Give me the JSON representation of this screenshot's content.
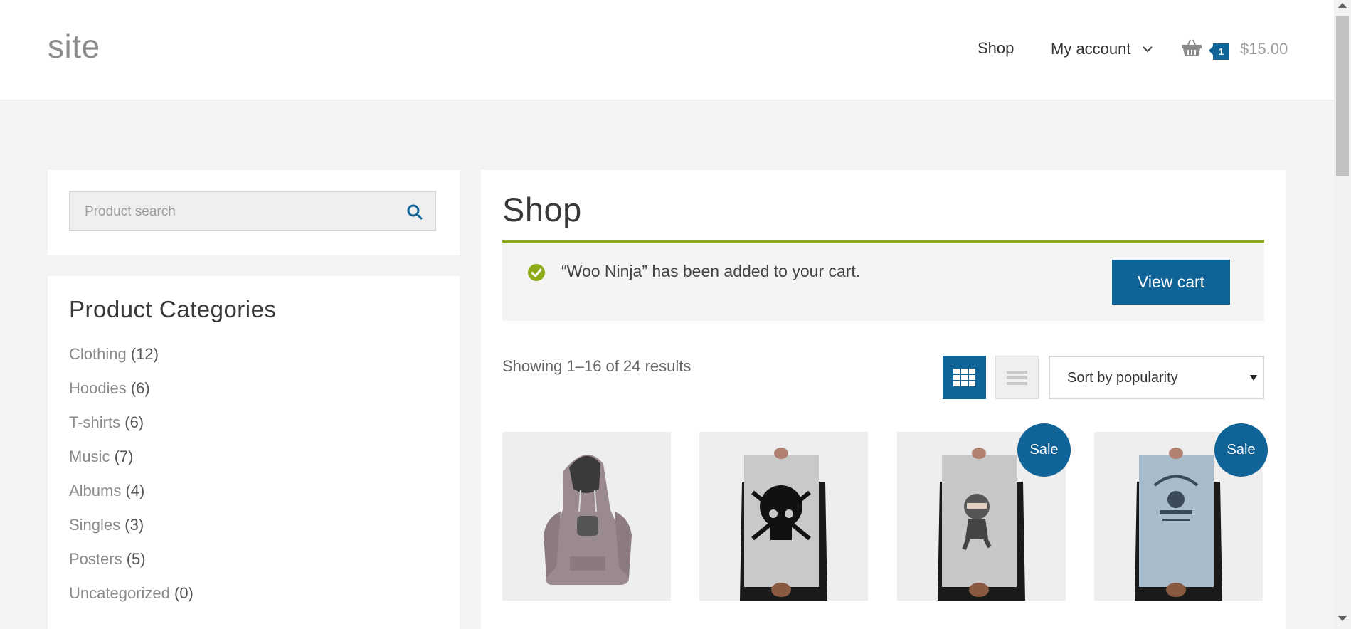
{
  "header": {
    "site_title": "site",
    "nav": {
      "shop": "Shop",
      "my_account": "My account"
    },
    "cart": {
      "count": "1",
      "total": "$15.00"
    }
  },
  "sidebar": {
    "search": {
      "placeholder": "Product search"
    },
    "categories": {
      "title": "Product Categories",
      "items": [
        {
          "name": "Clothing",
          "count": "(12)"
        },
        {
          "name": "Hoodies",
          "count": "(6)"
        },
        {
          "name": "T-shirts",
          "count": "(6)"
        },
        {
          "name": "Music",
          "count": "(7)"
        },
        {
          "name": "Albums",
          "count": "(4)"
        },
        {
          "name": "Singles",
          "count": "(3)"
        },
        {
          "name": "Posters",
          "count": "(5)"
        },
        {
          "name": "Uncategorized",
          "count": "(0)"
        }
      ]
    }
  },
  "main": {
    "title": "Shop",
    "notice": {
      "text": "“Woo Ninja” has been added to your cart.",
      "button": "View cart"
    },
    "result_count": "Showing 1–16 of 24 results",
    "sort": {
      "selected": "Sort by popularity"
    },
    "products": [
      {
        "image": "ninja-hoodie",
        "sale": ""
      },
      {
        "image": "ship-your-idea-poster",
        "sale": ""
      },
      {
        "image": "ninja-poster",
        "sale": "Sale"
      },
      {
        "image": "woothemes-poster",
        "sale": "Sale"
      }
    ]
  },
  "colors": {
    "accent": "#0f6397",
    "title_underline": "#8daa1a",
    "background": "#f3f3f3",
    "success_icon": "#8daa1a"
  }
}
